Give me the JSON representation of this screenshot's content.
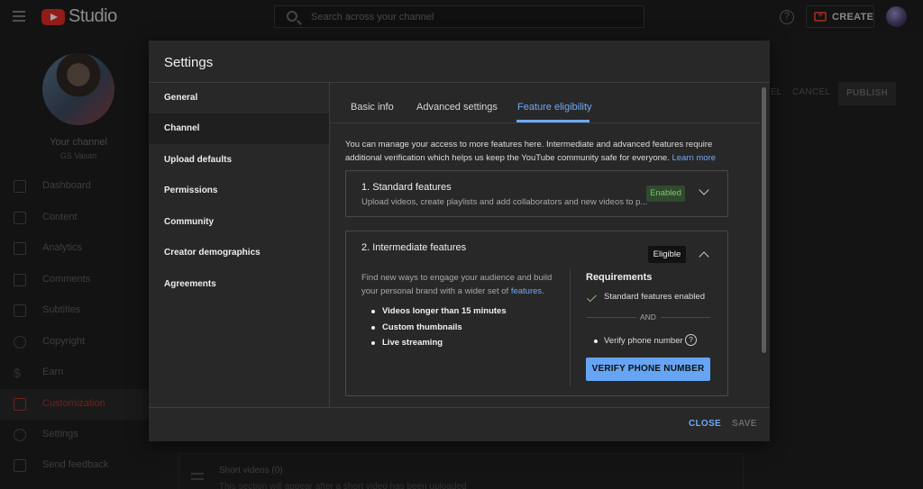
{
  "topbar": {
    "logo_text": "Studio",
    "search_placeholder": "Search across your channel",
    "create_label": "CREATE"
  },
  "sidebar": {
    "your_channel_label": "Your channel",
    "channel_name": "GS Vasan",
    "items": [
      {
        "label": "Dashboard",
        "icon": "dashboard-icon"
      },
      {
        "label": "Content",
        "icon": "content-icon"
      },
      {
        "label": "Analytics",
        "icon": "analytics-icon"
      },
      {
        "label": "Comments",
        "icon": "comments-icon"
      },
      {
        "label": "Subtitles",
        "icon": "subtitles-icon"
      },
      {
        "label": "Copyright",
        "icon": "copyright-icon"
      },
      {
        "label": "Earn",
        "icon": "earn-icon"
      },
      {
        "label": "Customization",
        "icon": "customization-icon",
        "active": true
      },
      {
        "label": "Settings",
        "icon": "settings-icon"
      },
      {
        "label": "Send feedback",
        "icon": "feedback-icon"
      }
    ]
  },
  "background": {
    "del_label": "EL",
    "cancel_label": "CANCEL",
    "publish_label": "PUBLISH",
    "short_videos_label": "Short videos (0)",
    "short_videos_sub": "This section will appear after a short video has been uploaded"
  },
  "dialog": {
    "title": "Settings",
    "nav": [
      {
        "label": "General"
      },
      {
        "label": "Channel",
        "active": true
      },
      {
        "label": "Upload defaults"
      },
      {
        "label": "Permissions"
      },
      {
        "label": "Community"
      },
      {
        "label": "Creator demographics"
      },
      {
        "label": "Agreements"
      }
    ],
    "tabs": [
      {
        "label": "Basic info"
      },
      {
        "label": "Advanced settings"
      },
      {
        "label": "Feature eligibility",
        "active": true
      }
    ],
    "intro_text": "You can manage your access to more features here. Intermediate and advanced features require additional verification which helps us keep the YouTube community safe for everyone.",
    "intro_link": "Learn more",
    "standard": {
      "title": "1. Standard features",
      "description": "Upload videos, create playlists and add collaborators and new videos to p...",
      "badge": "Enabled"
    },
    "intermediate": {
      "title": "2. Intermediate features",
      "badge": "Eligible",
      "description": "Find new ways to engage your audience and build your personal brand with a wider set of",
      "description_link": "features.",
      "bullets": [
        "Videos longer than 15 minutes",
        "Custom thumbnails",
        "Live streaming"
      ],
      "requirements_title": "Requirements",
      "requirement_1": "Standard features enabled",
      "and_label": "AND",
      "requirement_2": "Verify phone number",
      "verify_button": "VERIFY PHONE NUMBER"
    },
    "footer": {
      "close_label": "CLOSE",
      "save_label": "SAVE"
    }
  },
  "colors": {
    "accent_blue": "#6ea8f6",
    "brand_red": "#e02b24",
    "enabled_green": "#86c07a"
  }
}
